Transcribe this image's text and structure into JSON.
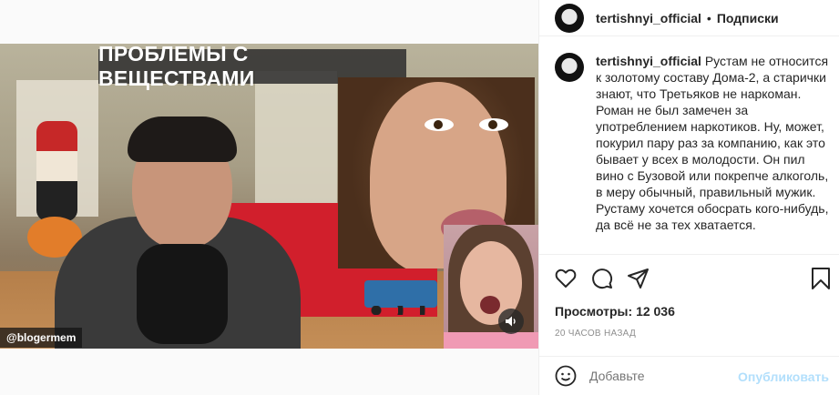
{
  "video": {
    "title_overlay": "ПРОБЛЕМЫ С ВЕЩЕСТВАМИ",
    "watermark": "@blogermem",
    "mute_icon": "speaker-icon"
  },
  "header": {
    "username": "tertishnyi_official",
    "separator": "•",
    "follow_label": "Подписки"
  },
  "caption": {
    "username": "tertishnyi_official",
    "text": "Рустам не относится к золотому составу Дома-2, а старички знают, что Третьяков не наркоман. Роман не был замечен за употреблением наркотиков. Ну, может, покурил пару раз за компанию, как это бывает у всех в молодости. Он пил вино с Бузовой или покрепче алкоголь, в меру обычный, правильный мужик. Рустаму хочется обосрать кого-нибудь, да всё не за тех хватается."
  },
  "actions": {
    "like_icon": "heart-icon",
    "comment_icon": "comment-icon",
    "share_icon": "paper-plane-icon",
    "save_icon": "bookmark-icon"
  },
  "stats": {
    "views_label": "Просмотры:",
    "views_count": "12 036",
    "time_ago": "20 ЧАСОВ НАЗАД"
  },
  "comment": {
    "placeholder": "Добавьте",
    "post_label": "Опубликовать",
    "emoji_icon": "smiley-icon"
  },
  "colors": {
    "text": "#262626",
    "secondary": "#8e8e8e",
    "post_disabled": "#b2dffc",
    "border": "#efefef"
  }
}
